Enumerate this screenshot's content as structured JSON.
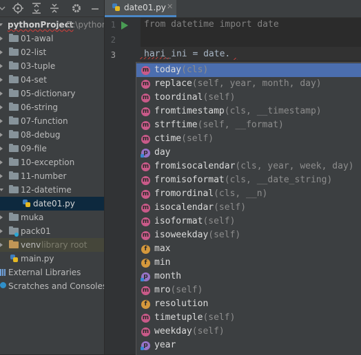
{
  "project_panel": {
    "root": {
      "name": "pythonProject",
      "path": "D:\\python"
    },
    "tree": [
      {
        "label": "01-awal",
        "type": "folder",
        "expanded": false
      },
      {
        "label": "02-list",
        "type": "folder",
        "expanded": false
      },
      {
        "label": "03-tuple",
        "type": "folder",
        "expanded": false
      },
      {
        "label": "04-set",
        "type": "folder",
        "expanded": false
      },
      {
        "label": "05-dictionary",
        "type": "folder",
        "expanded": false
      },
      {
        "label": "06-string",
        "type": "folder",
        "expanded": false
      },
      {
        "label": "07-function",
        "type": "folder",
        "expanded": false
      },
      {
        "label": "08-debug",
        "type": "folder",
        "expanded": false
      },
      {
        "label": "09-file",
        "type": "folder",
        "expanded": false
      },
      {
        "label": "10-exception",
        "type": "folder",
        "expanded": false
      },
      {
        "label": "11-number",
        "type": "folder",
        "expanded": false
      },
      {
        "label": "12-datetime",
        "type": "folder",
        "expanded": true
      },
      {
        "label": "date01.py",
        "type": "file",
        "selected": true
      },
      {
        "label": "muka",
        "type": "folder",
        "expanded": false
      },
      {
        "label": "pack01",
        "type": "folder",
        "expanded": false
      },
      {
        "label": "venv",
        "type": "folder",
        "expanded": false,
        "hint": "library root"
      },
      {
        "label": "main.py",
        "type": "file"
      }
    ],
    "external_libraries": "External Libraries",
    "scratches": "Scratches and Consoles"
  },
  "editor": {
    "tab_label": "date01.py",
    "line_numbers": [
      "1",
      "2",
      "3"
    ],
    "line1": "from datetime import date",
    "line3": "hari_ini = date."
  },
  "completion": {
    "items": [
      {
        "kind": "m",
        "name": "today",
        "args": "(cls)"
      },
      {
        "kind": "m",
        "name": "replace",
        "args": "(self, year, month, day)"
      },
      {
        "kind": "m",
        "name": "toordinal",
        "args": "(self)"
      },
      {
        "kind": "m",
        "name": "fromtimestamp",
        "args": "(cls, __timestamp)"
      },
      {
        "kind": "m",
        "name": "strftime",
        "args": "(self, __format)"
      },
      {
        "kind": "m",
        "name": "ctime",
        "args": "(self)"
      },
      {
        "kind": "p",
        "name": "day",
        "args": ""
      },
      {
        "kind": "m",
        "name": "fromisocalendar",
        "args": "(cls, year, week, day)"
      },
      {
        "kind": "m",
        "name": "fromisoformat",
        "args": "(cls, __date_string)"
      },
      {
        "kind": "m",
        "name": "fromordinal",
        "args": "(cls, __n)"
      },
      {
        "kind": "m",
        "name": "isocalendar",
        "args": "(self)"
      },
      {
        "kind": "m",
        "name": "isoformat",
        "args": "(self)"
      },
      {
        "kind": "m",
        "name": "isoweekday",
        "args": "(self)"
      },
      {
        "kind": "f",
        "name": "max",
        "args": ""
      },
      {
        "kind": "f",
        "name": "min",
        "args": ""
      },
      {
        "kind": "p",
        "name": "month",
        "args": ""
      },
      {
        "kind": "m",
        "name": "mro",
        "args": "(self)"
      },
      {
        "kind": "f",
        "name": "resolution",
        "args": ""
      },
      {
        "kind": "m",
        "name": "timetuple",
        "args": "(self)"
      },
      {
        "kind": "m",
        "name": "weekday",
        "args": "(self)"
      },
      {
        "kind": "p",
        "name": "year",
        "args": ""
      }
    ]
  }
}
